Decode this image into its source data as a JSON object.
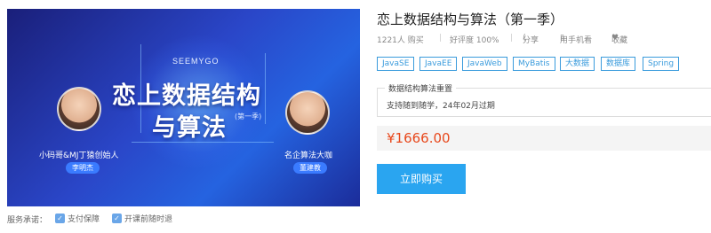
{
  "banner": {
    "brand": "SEEMYGO",
    "title_line1": "恋上数据结构",
    "title_line2": "与算法",
    "season": "(第一季)",
    "left_person_title": "小码哥&MJ丁猿创始人",
    "left_person_name": "李明杰",
    "right_person_title": "名企算法大咖",
    "right_person_name": "董建教"
  },
  "services": {
    "label": "服务承诺：",
    "items": [
      "支付保障",
      "开课前随时退"
    ]
  },
  "course": {
    "title": "恋上数据结构与算法（第一季）",
    "buyers": "1221人 购买",
    "rating": "好评度 100%",
    "share": "分享",
    "mobile": "用手机看",
    "favorite": "收藏"
  },
  "tags": [
    "JavaSE",
    "JavaEE",
    "JavaWeb",
    "MyBatis",
    "大数据",
    "数据库",
    "Spring"
  ],
  "plan": {
    "name": "数据结构算法重置",
    "description": "支持随到随学，24年02月过期"
  },
  "price": "¥1666.00",
  "buy_button": "立即购买",
  "colors": {
    "accent": "#2aa5f0",
    "tag_border": "#3a9bdc",
    "price": "#e8491d",
    "banner_bg": "#2a46c8"
  },
  "icons": {
    "share": "share-icon",
    "mobile": "phone-icon",
    "favorite": "heart-icon",
    "service": "shield-icon"
  }
}
